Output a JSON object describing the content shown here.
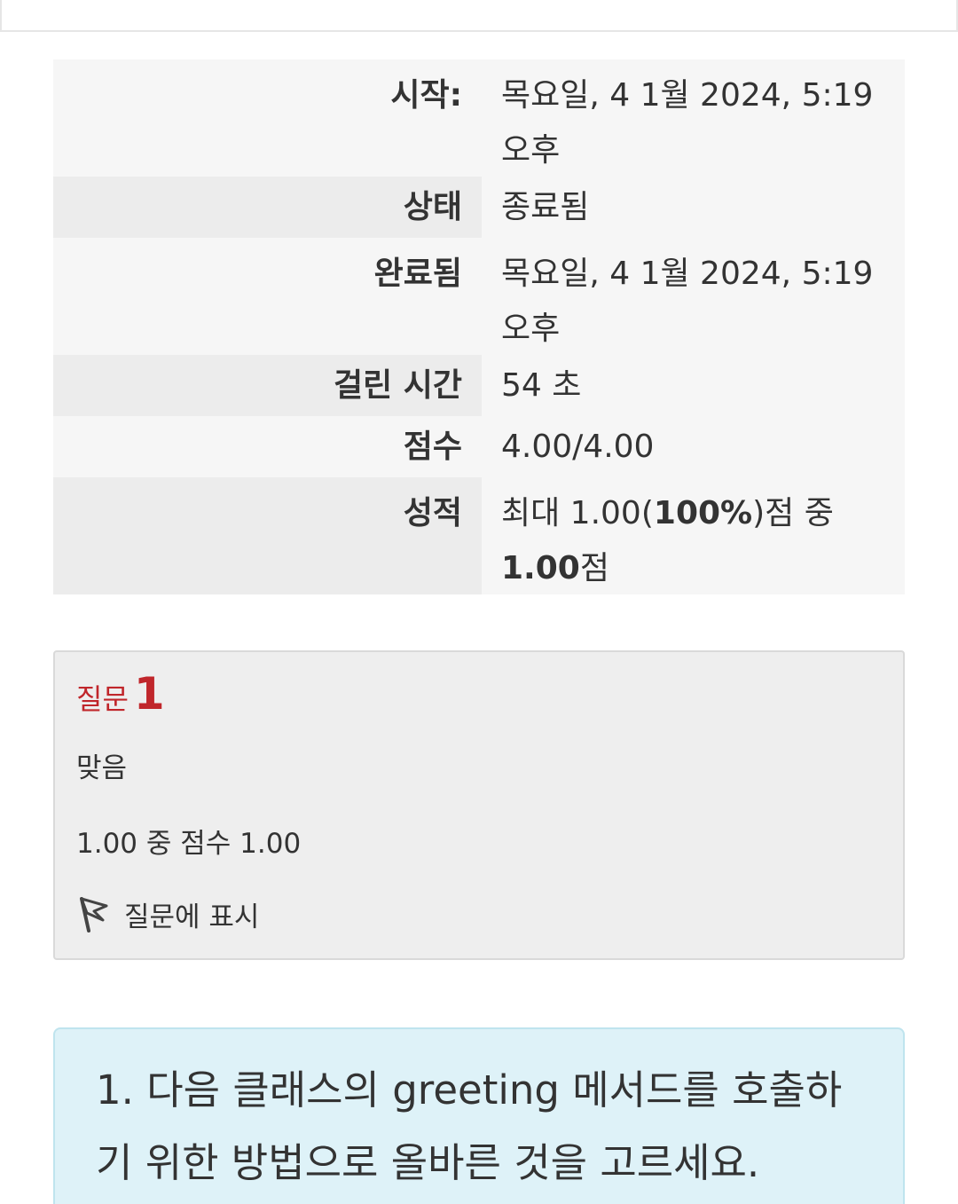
{
  "summary": {
    "rows": [
      {
        "label": "시작:",
        "value": "목요일, 4 1월 2024, 5:19 오후"
      },
      {
        "label": "상태",
        "value": "종료됨"
      },
      {
        "label": "완료됨",
        "value": "목요일, 4 1월 2024, 5:19 오후"
      },
      {
        "label": "걸린 시간",
        "value": "54 초"
      },
      {
        "label": "점수",
        "value": "4.00/4.00"
      },
      {
        "label": "성적",
        "value_prefix": "최대 1.00(",
        "value_pct": "100%",
        "value_mid": ")점 중",
        "value_score": "1.00",
        "value_suffix": "점"
      }
    ]
  },
  "question": {
    "label": "질문",
    "number": "1",
    "state": "맞음",
    "grade": "1.00 중 점수 1.00",
    "flag_label": "질문에 표시",
    "flag_icon": "flag-icon",
    "accent_color": "#c0262b"
  },
  "question_text": "1. 다음 클래스의 greeting 메서드를 호출하기 위한 방법으로 올바른 것을 고르세요."
}
